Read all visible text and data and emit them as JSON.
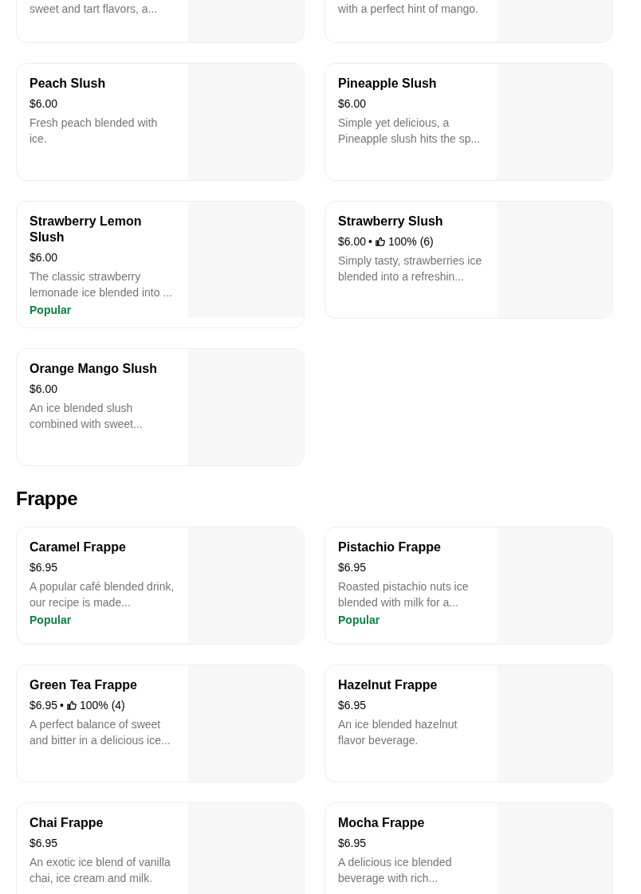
{
  "sections": [
    {
      "items": [
        {
          "kind": "partial",
          "description": "sweet and tart flavors, a..."
        },
        {
          "kind": "partial",
          "description": "with a perfect hint of mango."
        },
        {
          "kind": "item",
          "name": "Peach Slush",
          "price": "$6.00",
          "description": "Fresh peach blended with ice."
        },
        {
          "kind": "item",
          "name": "Pineapple Slush",
          "price": "$6.00",
          "description": "Simple yet delicious, a Pineapple slush hits the sp..."
        },
        {
          "kind": "item",
          "name": "Strawberry Lemon Slush",
          "price": "$6.00",
          "description": "The classic strawberry lemonade ice blended into ...",
          "badge": "Popular"
        },
        {
          "kind": "item",
          "name": "Strawberry Slush",
          "price": "$6.00",
          "separator": "•",
          "rating": "100% (6)",
          "description": "Simply tasty, strawberries ice blended into a refreshin..."
        },
        {
          "kind": "item",
          "name": "Orange Mango Slush",
          "price": "$6.00",
          "description": "An ice blended slush combined with sweet..."
        }
      ]
    },
    {
      "title": "Frappe",
      "items": [
        {
          "kind": "item",
          "name": "Caramel Frappe",
          "price": "$6.95",
          "description": "A popular café blended drink, our recipe is made...",
          "badge": "Popular"
        },
        {
          "kind": "item",
          "name": "Pistachio Frappe",
          "price": "$6.95",
          "description": "Roasted pistachio nuts ice blended with milk for a...",
          "badge": "Popular"
        },
        {
          "kind": "item",
          "name": "Green Tea Frappe",
          "price": "$6.95",
          "separator": "•",
          "rating": "100% (4)",
          "description": "A perfect balance of sweet and bitter in a delicious ice..."
        },
        {
          "kind": "item",
          "name": "Hazelnut Frappe",
          "price": "$6.95",
          "description": "An ice blended hazelnut flavor beverage."
        },
        {
          "kind": "item",
          "name": "Chai Frappe",
          "price": "$6.95",
          "description": "An exotic ice blend of vanilla chai, ice cream and milk."
        },
        {
          "kind": "item",
          "name": "Mocha Frappe",
          "price": "$6.95",
          "description": "A delicious ice blended beverage with rich..."
        }
      ]
    }
  ]
}
